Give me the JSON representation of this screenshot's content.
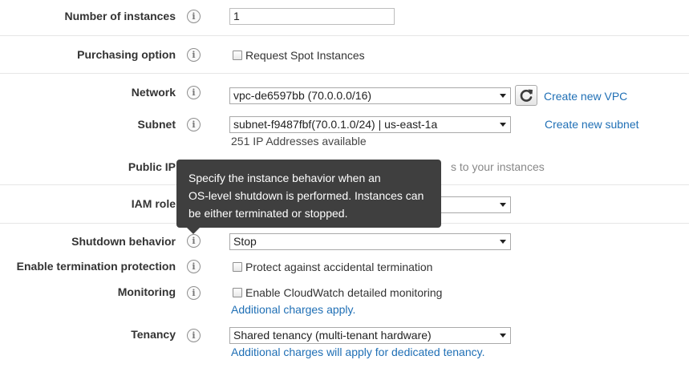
{
  "info_glyph": "i",
  "instances": {
    "label": "Number of instances",
    "value": "1"
  },
  "purchasing": {
    "label": "Purchasing option",
    "checkbox_label": "Request Spot Instances"
  },
  "network": {
    "label": "Network",
    "selected": "vpc-de6597bb (70.0.0.0/16)",
    "create_link": "Create new VPC"
  },
  "subnet": {
    "label": "Subnet",
    "selected": "subnet-f9487fbf(70.0.1.0/24) | us-east-1a",
    "create_link": "Create new subnet",
    "available": "251 IP Addresses available"
  },
  "public_ip": {
    "label": "Public IP",
    "visible_tail": "s to your instances"
  },
  "iam_role": {
    "label": "IAM role"
  },
  "shutdown": {
    "label": "Shutdown behavior",
    "selected": "Stop"
  },
  "tooltip": {
    "line1": "Specify the instance behavior when an",
    "line2": "OS-level shutdown is performed. Instances can",
    "line3": "be either terminated or stopped."
  },
  "termination": {
    "label": "Enable termination protection",
    "checkbox_label": "Protect against accidental termination"
  },
  "monitoring": {
    "label": "Monitoring",
    "checkbox_label": "Enable CloudWatch detailed monitoring",
    "charges_link": "Additional charges apply."
  },
  "tenancy": {
    "label": "Tenancy",
    "selected": "Shared tenancy (multi-tenant hardware)",
    "charges_link": "Additional charges will apply for dedicated tenancy."
  },
  "colors": {
    "link": "#1f6fb5",
    "tooltip_bg": "#3f3f3f",
    "separator": "#e6e6e6"
  }
}
